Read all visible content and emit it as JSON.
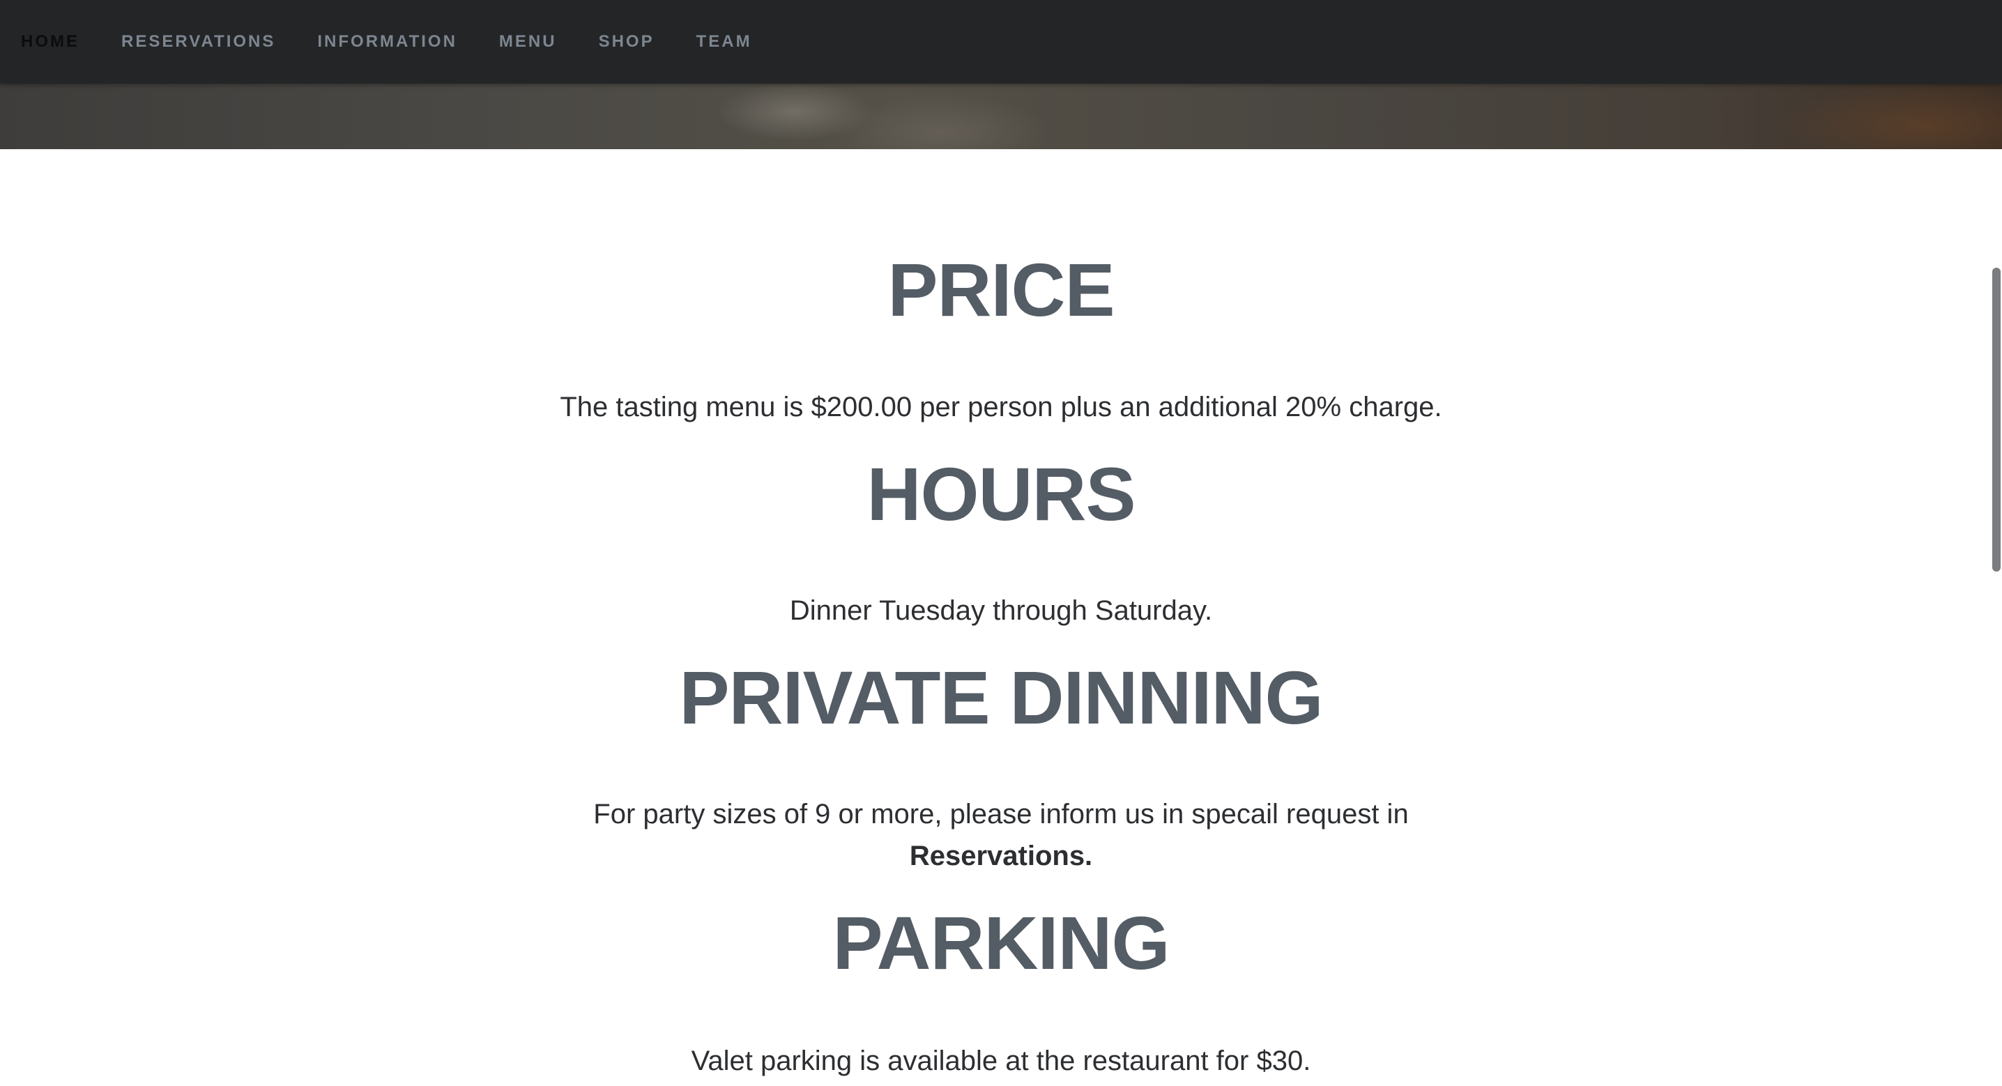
{
  "nav": {
    "items": [
      {
        "label": "HOME",
        "active": true
      },
      {
        "label": "RESERVATIONS",
        "active": false
      },
      {
        "label": "INFORMATION",
        "active": false
      },
      {
        "label": "MENU",
        "active": false
      },
      {
        "label": "SHOP",
        "active": false
      },
      {
        "label": "TEAM",
        "active": false
      }
    ]
  },
  "sections": {
    "price": {
      "title": "PRICE",
      "text": "The tasting menu is $200.00 per person plus an additional 20% charge."
    },
    "hours": {
      "title": "HOURS",
      "text": "Dinner Tuesday through Saturday."
    },
    "private_dining": {
      "title": "PRIVATE DINNING",
      "text": "For party sizes of 9 or more, please inform us in specail request in",
      "link_text": "Reservations."
    },
    "parking": {
      "title": "PARKING",
      "text": "Valet parking is available at the restaurant for $30."
    }
  },
  "colors": {
    "nav_background": "#232527",
    "nav_text": "#7d8690",
    "nav_active": "#0b0c0d",
    "heading": "#545c65",
    "body_text": "#2c2e31"
  }
}
